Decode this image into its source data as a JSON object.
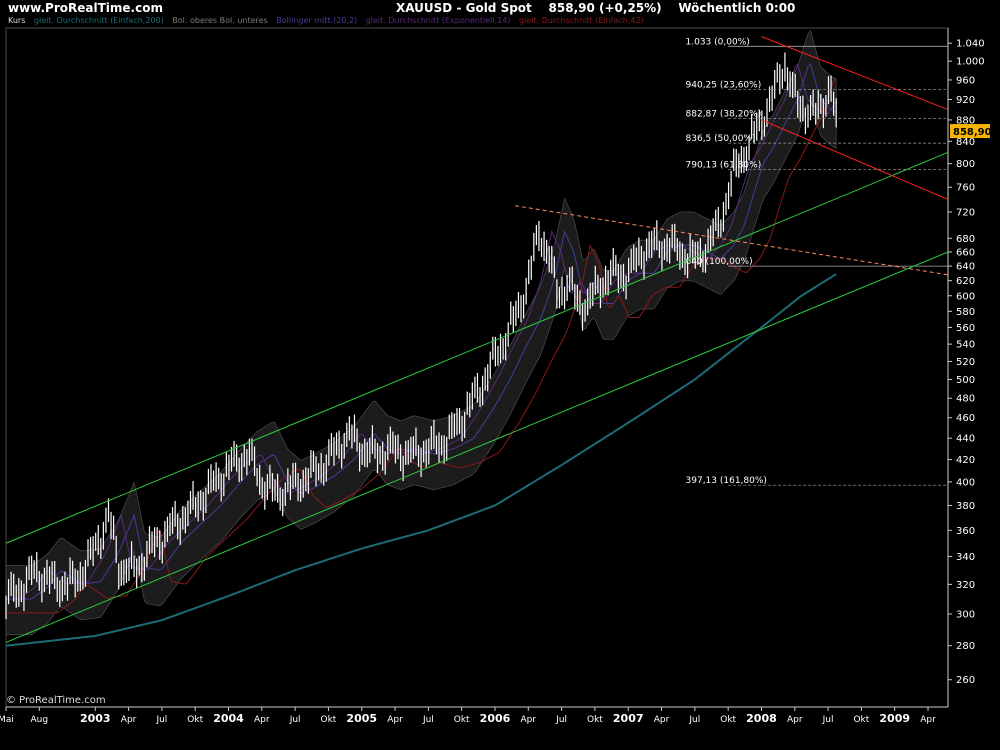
{
  "header": {
    "site": "www.ProRealTime.com",
    "symbol": "XAUUSD - Gold Spot",
    "price": "858,90 (+0,25%)",
    "interval": "Wöchentlich 0:00"
  },
  "legend": {
    "panel": "Kurs",
    "items": [
      {
        "label": "gleit. Durchschnitt (Einfach,200)",
        "color": "#1d6b74"
      },
      {
        "label": "Bol. oberes Bol. unteres",
        "color": "#7a7a7a"
      },
      {
        "label": "Bollinger mitt.(20,2)",
        "color": "#4a3a9a"
      },
      {
        "label": "gleit. Durchschnitt (Exponentiell,14)",
        "color": "#5a2a7a"
      },
      {
        "label": "gleit. Durchschnitt (Einfach,42)",
        "color": "#8a1a1a"
      }
    ]
  },
  "copyright": "© ProRealTime.com",
  "chart_data": {
    "type": "line",
    "title": "XAUUSD - Gold Spot",
    "yscale": "log",
    "ylim": [
      245,
      1075
    ],
    "xlim": [
      2002.33,
      2009.4
    ],
    "y_ticks": [
      260,
      280,
      300,
      320,
      340,
      360,
      380,
      400,
      420,
      440,
      460,
      480,
      500,
      520,
      540,
      560,
      580,
      600,
      620,
      640,
      660,
      680,
      720,
      760,
      800,
      840,
      880,
      920,
      960,
      1000,
      1040
    ],
    "y_tick_labels": [
      "260",
      "280",
      "300",
      "320",
      "340",
      "360",
      "380",
      "400",
      "420",
      "440",
      "460",
      "480",
      "500",
      "520",
      "540",
      "560",
      "580",
      "600",
      "620",
      "640",
      "660",
      "680",
      "720",
      "760",
      "800",
      "840",
      "880",
      "920",
      "960",
      "1.000",
      "1.040"
    ],
    "x_ticks": [
      {
        "label": "Mai",
        "t": 2002.33,
        "major": false
      },
      {
        "label": "Aug",
        "t": 2002.58,
        "major": false
      },
      {
        "label": "2003",
        "t": 2003.0,
        "major": true
      },
      {
        "label": "Apr",
        "t": 2003.25,
        "major": false
      },
      {
        "label": "Jul",
        "t": 2003.5,
        "major": false
      },
      {
        "label": "Okt",
        "t": 2003.75,
        "major": false
      },
      {
        "label": "2004",
        "t": 2004.0,
        "major": true
      },
      {
        "label": "Apr",
        "t": 2004.25,
        "major": false
      },
      {
        "label": "Jul",
        "t": 2004.5,
        "major": false
      },
      {
        "label": "Okt",
        "t": 2004.75,
        "major": false
      },
      {
        "label": "2005",
        "t": 2005.0,
        "major": true
      },
      {
        "label": "Apr",
        "t": 2005.25,
        "major": false
      },
      {
        "label": "Jul",
        "t": 2005.5,
        "major": false
      },
      {
        "label": "Okt",
        "t": 2005.75,
        "major": false
      },
      {
        "label": "2006",
        "t": 2006.0,
        "major": true
      },
      {
        "label": "Apr",
        "t": 2006.25,
        "major": false
      },
      {
        "label": "Jul",
        "t": 2006.5,
        "major": false
      },
      {
        "label": "Okt",
        "t": 2006.75,
        "major": false
      },
      {
        "label": "2007",
        "t": 2007.0,
        "major": true
      },
      {
        "label": "Apr",
        "t": 2007.25,
        "major": false
      },
      {
        "label": "Jul",
        "t": 2007.5,
        "major": false
      },
      {
        "label": "Okt",
        "t": 2007.75,
        "major": false
      },
      {
        "label": "2008",
        "t": 2008.0,
        "major": true
      },
      {
        "label": "Apr",
        "t": 2008.25,
        "major": false
      },
      {
        "label": "Jul",
        "t": 2008.5,
        "major": false
      },
      {
        "label": "Okt",
        "t": 2008.75,
        "major": false
      },
      {
        "label": "2009",
        "t": 2009.0,
        "major": true
      },
      {
        "label": "Apr",
        "t": 2009.25,
        "major": false
      }
    ],
    "price_series": {
      "name": "",
      "t": [
        2002.33,
        2002.45,
        2002.55,
        2002.7,
        2002.85,
        2002.98,
        2003.1,
        2003.18,
        2003.3,
        2003.45,
        2003.6,
        2003.75,
        2003.9,
        2004.02,
        2004.15,
        2004.25,
        2004.35,
        2004.45,
        2004.6,
        2004.75,
        2004.9,
        2005.0,
        2005.1,
        2005.2,
        2005.35,
        2005.5,
        2005.65,
        2005.8,
        2005.92,
        2006.05,
        2006.15,
        2006.25,
        2006.33,
        2006.4,
        2006.47,
        2006.55,
        2006.62,
        2006.7,
        2006.8,
        2006.9,
        2007.0,
        2007.1,
        2007.2,
        2007.3,
        2007.4,
        2007.5,
        2007.6,
        2007.68,
        2007.75,
        2007.82,
        2007.9,
        2008.0,
        2008.08,
        2008.17,
        2008.25,
        2008.33,
        2008.4,
        2008.47,
        2008.52,
        2008.57
      ],
      "y": [
        310,
        318,
        330,
        320,
        322,
        342,
        372,
        332,
        330,
        350,
        365,
        380,
        400,
        415,
        425,
        400,
        390,
        395,
        405,
        420,
        445,
        430,
        425,
        430,
        425,
        430,
        440,
        470,
        500,
        540,
        570,
        620,
        690,
        660,
        600,
        620,
        590,
        590,
        620,
        630,
        630,
        660,
        670,
        670,
        660,
        650,
        670,
        700,
        750,
        800,
        830,
        880,
        920,
        1000,
        920,
        900,
        890,
        920,
        940,
        860
      ]
    },
    "sma200": {
      "t": [
        2002.33,
        2003.0,
        2003.5,
        2004.0,
        2004.5,
        2005.0,
        2005.5,
        2006.0,
        2006.5,
        2007.0,
        2007.5,
        2008.0,
        2008.3,
        2008.57
      ],
      "y": [
        280,
        286,
        296,
        312,
        330,
        346,
        360,
        380,
        415,
        455,
        500,
        560,
        600,
        630
      ]
    },
    "levels": [
      {
        "label": "1.033 (0,00%)",
        "value": 1033
      },
      {
        "label": "940,25 (23,60%)",
        "value": 940.25
      },
      {
        "label": "882,87 (38,20%)",
        "value": 882.87
      },
      {
        "label": "836,5 (50,00%)",
        "value": 836.5
      },
      {
        "label": "790,13 (61,80%)",
        "value": 790.13
      },
      {
        "label": "640 (100,00%)",
        "value": 640
      },
      {
        "label": "397,13 (161,80%)",
        "value": 397.13
      }
    ],
    "trendlines": [
      {
        "kind": "channel-upper",
        "color": "#2ecc40",
        "from": [
          2002.33,
          350
        ],
        "to": [
          2009.4,
          820
        ]
      },
      {
        "kind": "channel-lower",
        "color": "#2ecc40",
        "from": [
          2002.33,
          282
        ],
        "to": [
          2009.4,
          660
        ]
      },
      {
        "kind": "resistance",
        "color": "#ff8a5a",
        "dashed": true,
        "from": [
          2006.15,
          730
        ],
        "to": [
          2009.4,
          628
        ]
      },
      {
        "kind": "down-upper",
        "color": "#ff2020",
        "from": [
          2008.0,
          1055
        ],
        "to": [
          2009.4,
          900
        ]
      },
      {
        "kind": "down-lower",
        "color": "#ff2020",
        "from": [
          2008.0,
          880
        ],
        "to": [
          2009.4,
          740
        ]
      }
    ],
    "last_price": {
      "value": 858.9,
      "label": "858,90"
    }
  }
}
